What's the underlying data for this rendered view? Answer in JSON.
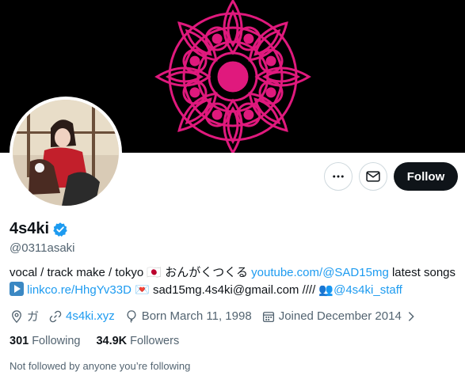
{
  "profile": {
    "display_name": "4s4ki",
    "handle": "@0311asaki",
    "verified": true,
    "follow_label": "Follow"
  },
  "bio": {
    "text1": "vocal / track make / tokyo ",
    "flag": "🇯🇵",
    "text2": " おんがくつくる ",
    "youtube_link": "youtube.com/@SAD15mg",
    "text3": " latest songs",
    "play_glyph": "▶",
    "linkco": "linkco.re/HhgYv33D",
    "mail_glyph": "💌",
    "email": "sad15mg.4s4ki@gmail.com",
    "slashes": " //// ",
    "staff_glyph": "👥",
    "staff_handle": "@4s4ki_staff"
  },
  "meta": {
    "location": "ガ",
    "website": "4s4ki.xyz",
    "born": "Born March 11, 1998",
    "joined": "Joined December 2014"
  },
  "stats": {
    "following_count": "301",
    "following_label": "Following",
    "followers_count": "34.9K",
    "followers_label": "Followers"
  },
  "not_followed_text": "Not followed by anyone you’re following",
  "colors": {
    "banner_bg": "#000000",
    "banner_pattern": "#e0197d",
    "link": "#1d9bf0",
    "verified": "#1d9bf0",
    "follow_button": "#0f1419"
  }
}
